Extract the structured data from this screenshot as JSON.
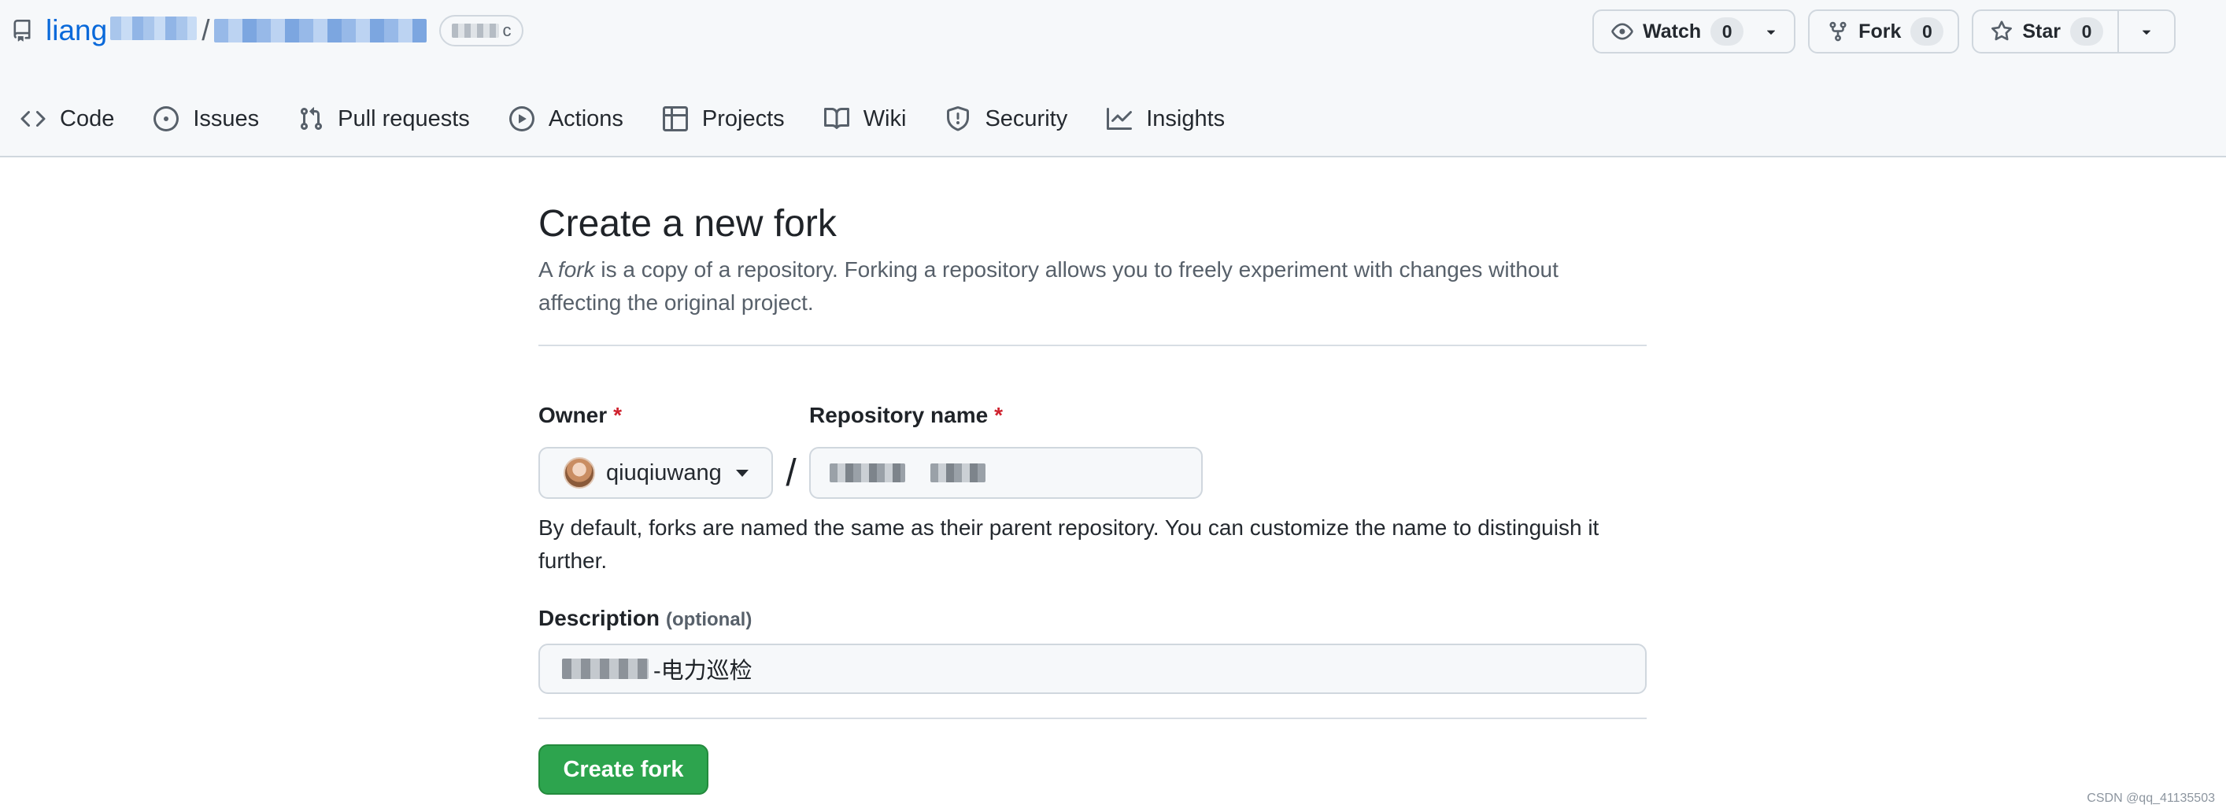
{
  "header": {
    "owner_visible": "liang",
    "separator": "/",
    "watch": {
      "label": "Watch",
      "count": "0"
    },
    "fork": {
      "label": "Fork",
      "count": "0"
    },
    "star": {
      "label": "Star",
      "count": "0"
    },
    "badge_tail": "c"
  },
  "nav": {
    "tabs": [
      {
        "label": "Code",
        "icon": "code-icon"
      },
      {
        "label": "Issues",
        "icon": "issue-opened-icon"
      },
      {
        "label": "Pull requests",
        "icon": "git-pull-request-icon"
      },
      {
        "label": "Actions",
        "icon": "play-icon"
      },
      {
        "label": "Projects",
        "icon": "table-icon"
      },
      {
        "label": "Wiki",
        "icon": "book-icon"
      },
      {
        "label": "Security",
        "icon": "shield-icon"
      },
      {
        "label": "Insights",
        "icon": "graph-icon"
      }
    ]
  },
  "main": {
    "title": "Create a new fork",
    "intro_prefix": "A ",
    "intro_em": "fork",
    "intro_suffix": " is a copy of a repository. Forking a repository allows you to freely experiment with changes without affecting the original project.",
    "owner_label": "Owner",
    "required_mark": "*",
    "owner_value": "qiuqiuwang",
    "slash": "/",
    "repo_label": "Repository name",
    "help_text": "By default, forks are named the same as their parent repository. You can customize the name to distinguish it further.",
    "description_label": "Description",
    "description_optional": "(optional)",
    "description_value_visible": "-电力巡检",
    "create_button": "Create fork"
  },
  "watermark": "CSDN @qq_41135503",
  "colors": {
    "link": "#0969da",
    "primary_button": "#2da44e",
    "required": "#cf222e",
    "header_bg": "#f6f8fa",
    "border": "#d0d7de"
  }
}
